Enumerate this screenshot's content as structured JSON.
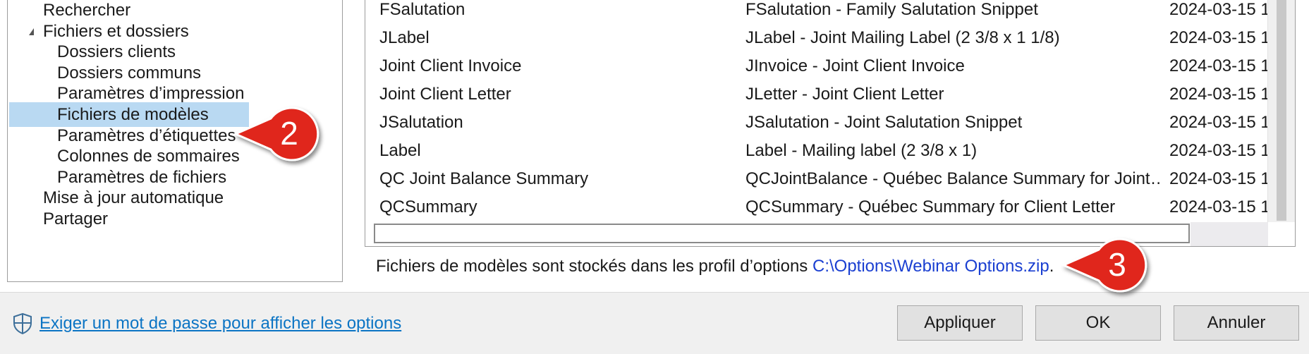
{
  "tree": {
    "items": [
      {
        "label": "Rechercher",
        "level": 1,
        "selected": false
      },
      {
        "label": "Fichiers et dossiers",
        "level": 1,
        "expanded": true,
        "selected": false
      },
      {
        "label": "Dossiers clients",
        "level": 2,
        "selected": false
      },
      {
        "label": "Dossiers communs",
        "level": 2,
        "selected": false
      },
      {
        "label": "Paramètres d’impression",
        "level": 2,
        "selected": false
      },
      {
        "label": "Fichiers de modèles",
        "level": 2,
        "selected": true
      },
      {
        "label": "Paramètres d’étiquettes",
        "level": 2,
        "selected": false
      },
      {
        "label": "Colonnes de sommaires",
        "level": 2,
        "selected": false
      },
      {
        "label": "Paramètres de fichiers",
        "level": 2,
        "selected": false
      },
      {
        "label": "Mise à jour automatique",
        "level": 1,
        "selected": false
      },
      {
        "label": "Partager",
        "level": 1,
        "selected": false
      }
    ]
  },
  "templates": {
    "rows": [
      {
        "name": "FSalutation",
        "description": "FSalutation - Family Salutation Snippet",
        "date": "2024-03-15 1"
      },
      {
        "name": "JLabel",
        "description": "JLabel - Joint Mailing Label (2 3/8 x 1 1/8)",
        "date": "2024-03-15 1"
      },
      {
        "name": "Joint Client Invoice",
        "description": "JInvoice - Joint Client Invoice",
        "date": "2024-03-15 1"
      },
      {
        "name": "Joint Client Letter",
        "description": "JLetter - Joint Client Letter",
        "date": "2024-03-15 1"
      },
      {
        "name": "JSalutation",
        "description": "JSalutation - Joint Salutation Snippet",
        "date": "2024-03-15 1"
      },
      {
        "name": "Label",
        "description": "Label - Mailing label (2 3/8 x 1)",
        "date": "2024-03-15 1"
      },
      {
        "name": "QC Joint Balance Summary",
        "description": "QCJointBalance - Québec Balance Summary for Joint…",
        "date": "2024-03-15 1"
      },
      {
        "name": "QCSummary",
        "description": "QCSummary - Québec Summary for Client Letter",
        "date": "2024-03-15 1"
      }
    ]
  },
  "info": {
    "text": "Fichiers de modèles sont stockés dans les profil d’options ",
    "path": "C:\\Options\\Webinar Options.zip",
    "suffix": "."
  },
  "callouts": {
    "two": "2",
    "three": "3"
  },
  "footer": {
    "password_link": "Exiger un mot de passe pour afficher les options",
    "apply_label": "Appliquer",
    "ok_label": "OK",
    "cancel_label": "Annuler"
  },
  "colors": {
    "selection": "#b9d9f2",
    "link": "#0b74c4",
    "path": "#1a3fd1",
    "callout": "#e0261b"
  }
}
